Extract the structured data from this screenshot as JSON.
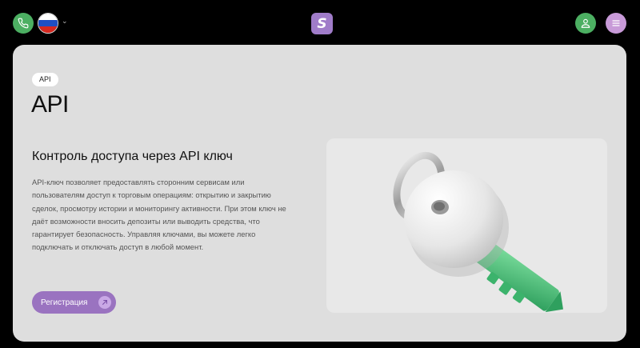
{
  "header": {
    "phone_icon": "phone-icon",
    "language_flag": "russia-flag",
    "logo_letter": "S",
    "user_icon": "user-icon",
    "menu_icon": "menu-icon",
    "colors": {
      "green": "#4caf62",
      "purple": "#a07cc9",
      "menu": "#c89ad8"
    }
  },
  "main": {
    "badge": "API",
    "title": "API",
    "section_title": "Контроль доступа через API ключ",
    "description": "API-ключ позволяет предоставлять сторонним сервисам или пользователям доступ к торговым операциям: открытию и закрытию сделок, просмотру истории и мониторингу активности. При этом ключ не даёт возможности вносить депозиты или выводить средства, что гарантирует безопасность. Управляя ключами, вы можете легко подключать и отключать доступ в любой момент.",
    "register_button": "Регистрация",
    "illustration": "key-illustration"
  }
}
